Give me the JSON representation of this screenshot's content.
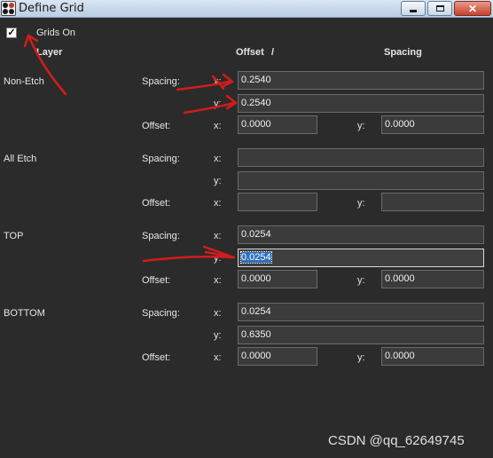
{
  "window": {
    "title": "Define Grid",
    "close_glyph": "✕"
  },
  "grids_on": {
    "label": "Grids On",
    "checked": true,
    "mark": "✓"
  },
  "headers": {
    "layer": "Layer",
    "offset": "Offset",
    "slash": "/",
    "spacing": "Spacing"
  },
  "common": {
    "spacing": "Spacing:",
    "offset": "Offset:",
    "x": "x:",
    "y": "y:"
  },
  "layers": [
    {
      "name": "Non-Etch",
      "spacing_x": "0.2540",
      "spacing_y": "0.2540",
      "offset_x": "0.0000",
      "offset_y": "0.0000"
    },
    {
      "name": "All Etch",
      "spacing_x": "",
      "spacing_y": "",
      "offset_x": "",
      "offset_y": ""
    },
    {
      "name": "TOP",
      "spacing_x": "0.0254",
      "spacing_y": "0.0254",
      "offset_x": "0.0000",
      "offset_y": "0.0000"
    },
    {
      "name": "BOTTOM",
      "spacing_x": "0.0254",
      "spacing_y": "0.6350",
      "offset_x": "0.0000",
      "offset_y": "0.0000"
    }
  ],
  "focused_field": "TOP spacing y",
  "watermark": "CSDN @qq_62649745",
  "colors": {
    "background": "#2b2b2b",
    "field": "#3b3b3b",
    "annotation": "#d41b1b",
    "selection": "#2f6fbd"
  }
}
